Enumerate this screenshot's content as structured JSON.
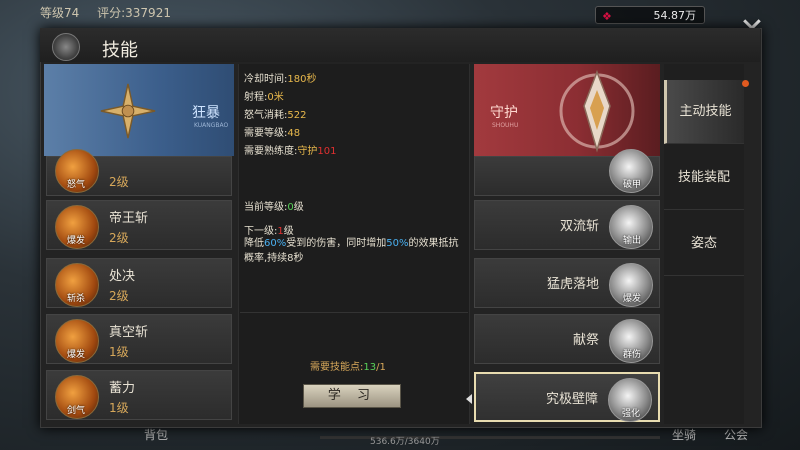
{
  "hud": {
    "level_text": "等级74",
    "score_text": "评分:337921",
    "gold_text": "54.87万",
    "bottom_left": "背包",
    "mount": "坐骑",
    "guild": "公会",
    "xp_text": "536.6万/3640万"
  },
  "window": {
    "title": "技能"
  },
  "left_banner": {
    "label": "狂暴",
    "sub": "KUANGBAO"
  },
  "right_banner": {
    "label": "守护",
    "sub": "SHOUHU"
  },
  "left_skills": [
    {
      "name": "",
      "tag": "怒气",
      "level": "2级"
    },
    {
      "name": "帝王斩",
      "tag": "爆发",
      "level": "2级"
    },
    {
      "name": "处决",
      "tag": "斩杀",
      "level": "2级"
    },
    {
      "name": "真空斩",
      "tag": "爆发",
      "level": "1级"
    },
    {
      "name": "蓄力",
      "tag": "剑气",
      "level": "1级"
    }
  ],
  "right_skills": [
    {
      "name": "",
      "tag": "破甲"
    },
    {
      "name": "双流斩",
      "tag": "输出"
    },
    {
      "name": "猛虎落地",
      "tag": "爆发"
    },
    {
      "name": "献祭",
      "tag": "群伤"
    },
    {
      "name": "究极壁障",
      "tag": "强化"
    }
  ],
  "details": {
    "cooldown_label": "冷却时间:",
    "cooldown": "180秒",
    "range_label": "射程:",
    "range": "0米",
    "rage_label": "怒气消耗:",
    "rage": "522",
    "req_level_label": "需要等级:",
    "req_level": "48",
    "mastery_label": "需要熟练度:",
    "mastery_name": "守护",
    "mastery_value": "101",
    "current_label": "当前等级:",
    "current_value": "0",
    "current_unit": "级",
    "next_label": "下一级:",
    "next_value": "1",
    "next_unit": "级",
    "desc_1": "降低",
    "desc_pct1": "60%",
    "desc_2": "受到的伤害，同时增加",
    "desc_pct2": "50%",
    "desc_3": "的效果抵抗概率,持续8秒",
    "points_label": "需要技能点:",
    "points_have": "13",
    "points_need": "/1"
  },
  "learn_button": "学 习",
  "tabs": [
    "主动技能",
    "技能装配",
    "姿态"
  ]
}
